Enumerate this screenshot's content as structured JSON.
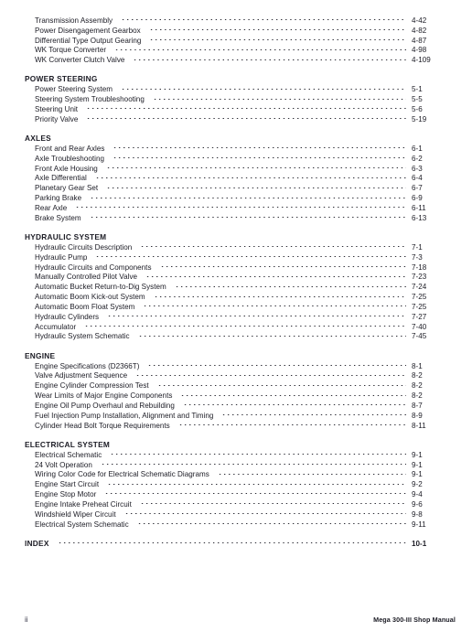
{
  "document": {
    "type": "table-of-contents",
    "folio": "ii",
    "manual_title": "Mega 300-III Shop Manual"
  },
  "sections": [
    {
      "heading": null,
      "entries": [
        {
          "label": "Transmission Assembly",
          "page": "4-42"
        },
        {
          "label": "Power Disengagement Gearbox",
          "page": "4-82"
        },
        {
          "label": "Differential Type Output Gearing",
          "page": "4-87"
        },
        {
          "label": "WK Torque Converter",
          "page": "4-98"
        },
        {
          "label": "WK Converter Clutch Valve",
          "page": "4-109"
        }
      ]
    },
    {
      "heading": "POWER STEERING",
      "entries": [
        {
          "label": "Power Steering System",
          "page": "5-1"
        },
        {
          "label": "Steering System Troubleshooting",
          "page": "5-5"
        },
        {
          "label": "Steering Unit",
          "page": "5-6"
        },
        {
          "label": "Priority Valve",
          "page": "5-19"
        }
      ]
    },
    {
      "heading": "AXLES",
      "entries": [
        {
          "label": "Front and Rear Axles",
          "page": "6-1"
        },
        {
          "label": "Axle Troubleshooting",
          "page": "6-2"
        },
        {
          "label": "Front Axle Housing",
          "page": "6-3"
        },
        {
          "label": "Axle Differential",
          "page": "6-4"
        },
        {
          "label": "Planetary Gear Set",
          "page": "6-7"
        },
        {
          "label": "Parking Brake",
          "page": "6-9"
        },
        {
          "label": "Rear Axle",
          "page": "6-11"
        },
        {
          "label": "Brake System",
          "page": "6-13"
        }
      ]
    },
    {
      "heading": "HYDRAULIC SYSTEM",
      "entries": [
        {
          "label": "Hydraulic Circuits Description",
          "page": "7-1"
        },
        {
          "label": "Hydraulic Pump",
          "page": "7-3"
        },
        {
          "label": "Hydraulic Circuits and Components",
          "page": "7-18"
        },
        {
          "label": "Manually Controlled Pilot Valve",
          "page": "7-23"
        },
        {
          "label": "Automatic Bucket Return-to-Dig System",
          "page": "7-24"
        },
        {
          "label": "Automatic Boom Kick-out System",
          "page": "7-25"
        },
        {
          "label": "Automatic Boom Float System",
          "page": "7-25"
        },
        {
          "label": "Hydraulic Cylinders",
          "page": "7-27"
        },
        {
          "label": "Accumulator",
          "page": "7-40"
        },
        {
          "label": "Hydraulic System Schematic",
          "page": "7-45"
        }
      ]
    },
    {
      "heading": "ENGINE",
      "entries": [
        {
          "label": "Engine Specifications (D2366T)",
          "page": "8-1"
        },
        {
          "label": "Valve Adjustment Sequence",
          "page": "8-2"
        },
        {
          "label": "Engine Cylinder Compression Test",
          "page": "8-2"
        },
        {
          "label": "Wear Limits of Major Engine Components",
          "page": "8-2"
        },
        {
          "label": "Engine Oil Pump Overhaul and Rebuilding",
          "page": "8-7"
        },
        {
          "label": "Fuel Injection Pump Installation, Alignment and Timing",
          "page": "8-9"
        },
        {
          "label": "Cylinder Head Bolt Torque Requirements",
          "page": "8-11"
        }
      ]
    },
    {
      "heading": "ELECTRICAL SYSTEM",
      "entries": [
        {
          "label": "Electrical Schematic",
          "page": "9-1"
        },
        {
          "label": "24 Volt Operation",
          "page": "9-1"
        },
        {
          "label": "Wiring Color Code for Electrical Schematic Diagrams",
          "page": "9-1"
        },
        {
          "label": "Engine Start Circuit",
          "page": "9-2"
        },
        {
          "label": "Engine Stop Motor",
          "page": "9-4"
        },
        {
          "label": "Engine Intake Preheat Circuit",
          "page": "9-6"
        },
        {
          "label": "Windshield Wiper Circuit",
          "page": "9-8"
        },
        {
          "label": "Electrical System Schematic",
          "page": "9-11"
        }
      ]
    },
    {
      "heading": "INDEX",
      "heading_page": "10-1",
      "entries": []
    }
  ]
}
